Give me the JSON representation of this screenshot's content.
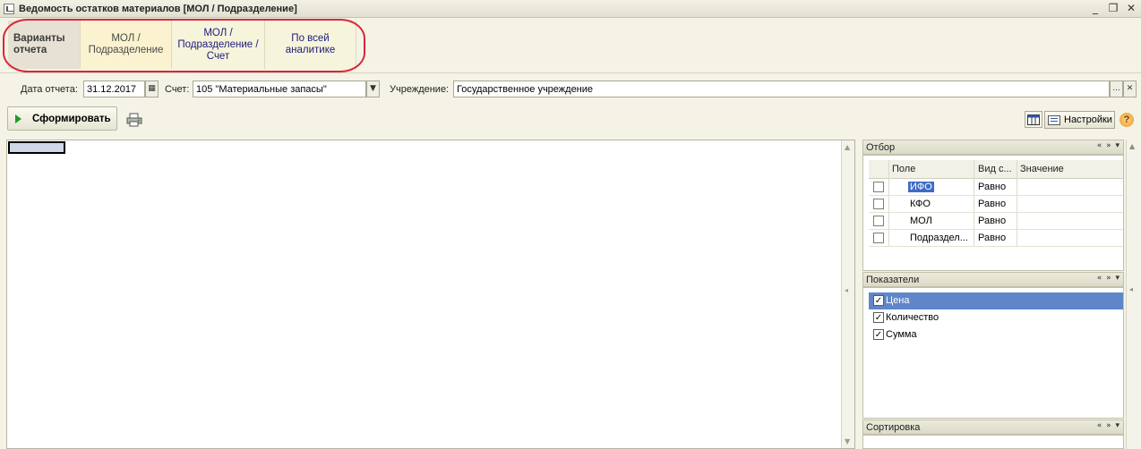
{
  "window": {
    "title": "Ведомость остатков материалов [МОЛ / Подразделение]",
    "minimize_glyph": "_",
    "restore_glyph": "❐",
    "close_glyph": "✕"
  },
  "variants": {
    "header": "Варианты отчета",
    "items": [
      {
        "label": "МОЛ / Подразделение"
      },
      {
        "label": "МОЛ / Подразделение / Счет"
      },
      {
        "label": "По всей аналитике"
      }
    ]
  },
  "params": {
    "date_label": "Дата отчета:",
    "date_value": "31.12.2017",
    "account_label": "Счет:",
    "account_value": "105 \"Материальные запасы\"",
    "institution_label": "Учреждение:",
    "institution_value": "Государственное учреждение",
    "select_glyph": "...",
    "clear_glyph": "✕",
    "dropdown_glyph": "▼",
    "calendar_glyph": "▦"
  },
  "toolbar": {
    "generate_label": "Сформировать",
    "settings_label": "Настройки",
    "help_glyph": "?"
  },
  "filter_panel": {
    "title": "Отбор",
    "controls": "« » ▾",
    "columns": [
      "Поле",
      "Вид с...",
      "Значение"
    ],
    "rows": [
      {
        "field": "ИФО",
        "condition": "Равно",
        "value": ""
      },
      {
        "field": "КФО",
        "condition": "Равно",
        "value": ""
      },
      {
        "field": "МОЛ",
        "condition": "Равно",
        "value": ""
      },
      {
        "field": "Подраздел...",
        "condition": "Равно",
        "value": ""
      }
    ]
  },
  "indicators_panel": {
    "title": "Показатели",
    "controls": "« » ▾",
    "items": [
      {
        "label": "Цена",
        "checked": true,
        "selected": true
      },
      {
        "label": "Количество",
        "checked": true,
        "selected": false
      },
      {
        "label": "Сумма",
        "checked": true,
        "selected": false
      }
    ]
  },
  "sort_panel": {
    "title": "Сортировка",
    "controls": "« » ▾"
  },
  "colors": {
    "highlight_ellipse": "#d9263a",
    "selection": "#3d6cc6",
    "play_green": "#1f9a2a"
  }
}
